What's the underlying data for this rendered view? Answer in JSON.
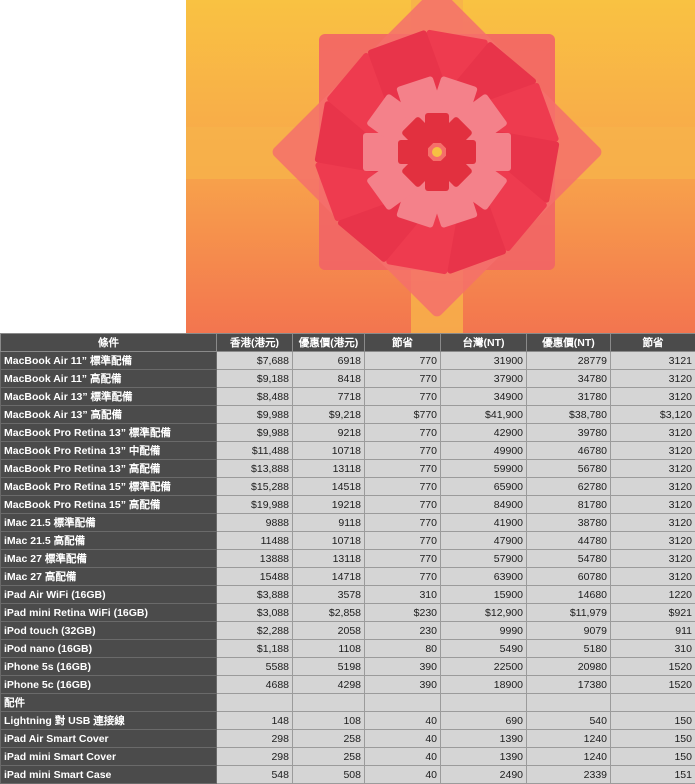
{
  "banner": {
    "image": "gift-bow-illustration",
    "colors": {
      "top": "#f9c242",
      "bottom": "#f3754f",
      "bow": "#e8344a",
      "ribbon": "#f7b24a"
    }
  },
  "table": {
    "headers": [
      "條件",
      "香港(港元)",
      "優惠價(港元)",
      "節省",
      "台灣(NT)",
      "優惠價(NT)",
      "節省"
    ],
    "rows": [
      [
        "MacBook Air 11” 標準配備",
        "$7,688",
        "6918",
        "770",
        "31900",
        "28779",
        "3121"
      ],
      [
        "MacBook Air 11” 高配備",
        "$9,188",
        "8418",
        "770",
        "37900",
        "34780",
        "3120"
      ],
      [
        "MacBook Air 13” 標準配備",
        "$8,488",
        "7718",
        "770",
        "34900",
        "31780",
        "3120"
      ],
      [
        "MacBook Air 13” 高配備",
        "$9,988",
        "$9,218",
        "$770",
        "$41,900",
        "$38,780",
        "$3,120"
      ],
      [
        "MacBook Pro Retina 13” 標準配備",
        "$9,988",
        "9218",
        "770",
        "42900",
        "39780",
        "3120"
      ],
      [
        "MacBook Pro Retina 13” 中配備",
        "$11,488",
        "10718",
        "770",
        "49900",
        "46780",
        "3120"
      ],
      [
        "MacBook Pro Retina 13” 高配備",
        "$13,888",
        "13118",
        "770",
        "59900",
        "56780",
        "3120"
      ],
      [
        "MacBook Pro Retina 15” 標準配備",
        "$15,288",
        "14518",
        "770",
        "65900",
        "62780",
        "3120"
      ],
      [
        "MacBook Pro Retina 15” 高配備",
        "$19,988",
        "19218",
        "770",
        "84900",
        "81780",
        "3120"
      ],
      [
        "iMac 21.5 標準配備",
        "9888",
        "9118",
        "770",
        "41900",
        "38780",
        "3120"
      ],
      [
        "iMac 21.5 高配備",
        "11488",
        "10718",
        "770",
        "47900",
        "44780",
        "3120"
      ],
      [
        "iMac 27 標準配備",
        "13888",
        "13118",
        "770",
        "57900",
        "54780",
        "3120"
      ],
      [
        "iMac 27 高配備",
        "15488",
        "14718",
        "770",
        "63900",
        "60780",
        "3120"
      ],
      [
        "iPad Air WiFi (16GB)",
        "$3,888",
        "3578",
        "310",
        "15900",
        "14680",
        "1220"
      ],
      [
        "iPad mini Retina WiFi (16GB)",
        "$3,088",
        "$2,858",
        "$230",
        "$12,900",
        "$11,979",
        "$921"
      ],
      [
        "iPod touch (32GB)",
        "$2,288",
        "2058",
        "230",
        "9990",
        "9079",
        "911"
      ],
      [
        "iPod nano (16GB)",
        "$1,188",
        "1108",
        "80",
        "5490",
        "5180",
        "310"
      ],
      [
        "iPhone 5s (16GB)",
        "5588",
        "5198",
        "390",
        "22500",
        "20980",
        "1520"
      ],
      [
        "iPhone 5c (16GB)",
        "4688",
        "4298",
        "390",
        "18900",
        "17380",
        "1520"
      ],
      [
        "配件",
        "",
        "",
        "",
        "",
        "",
        ""
      ],
      [
        "Lightning 對 USB 連接線",
        "148",
        "108",
        "40",
        "690",
        "540",
        "150"
      ],
      [
        "iPad Air Smart Cover",
        "298",
        "258",
        "40",
        "1390",
        "1240",
        "150"
      ],
      [
        "iPad mini Smart Cover",
        "298",
        "258",
        "40",
        "1390",
        "1240",
        "150"
      ],
      [
        "iPad mini Smart Case",
        "548",
        "508",
        "40",
        "2490",
        "2339",
        "151"
      ]
    ]
  }
}
